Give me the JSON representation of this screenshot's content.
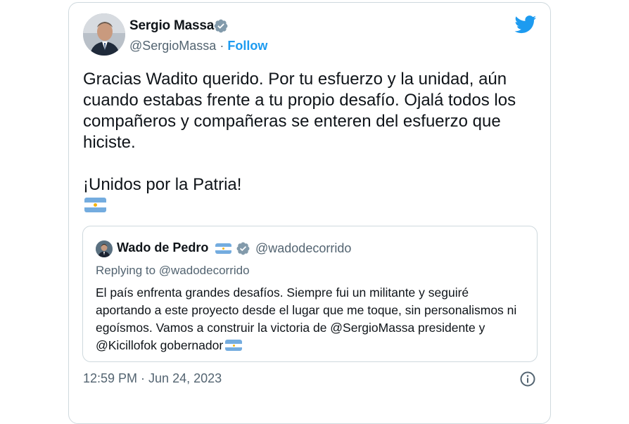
{
  "author": {
    "name": "Sergio Massa",
    "handle": "@SergioMassa",
    "separator": " · ",
    "follow_label": "Follow"
  },
  "tweet": {
    "text": "Gracias Wadito querido. Por tu esfuerzo y la unidad, aún cuando estabas frente a tu propio desafío. Ojalá todos los compañeros y compañeras se enteren del esfuerzo que hiciste.\n\n¡Unidos por la Patria!"
  },
  "quoted": {
    "name": "Wado de Pedro",
    "handle": "@wadodecorrido",
    "replying_to": "Replying to @wadodecorrido",
    "text": "El país enfrenta grandes desafíos. Siempre fui un militante y seguiré aportando a este proyecto desde el lugar que me toque, sin personalismos ni egoísmos. Vamos a construir la victoria de @SergioMassa presidente y @Kicillofok gobernador"
  },
  "footer": {
    "timestamp": "12:59 PM · Jun 24, 2023"
  },
  "icons": {
    "verified": "verified-badge-icon",
    "brand": "twitter-bird-icon",
    "info": "info-icon",
    "flag": "argentina-flag-emoji"
  },
  "colors": {
    "accent": "#1d9bf0",
    "secondary_text": "#536471",
    "border": "#cfd9de",
    "flag_blue": "#74acdf"
  }
}
